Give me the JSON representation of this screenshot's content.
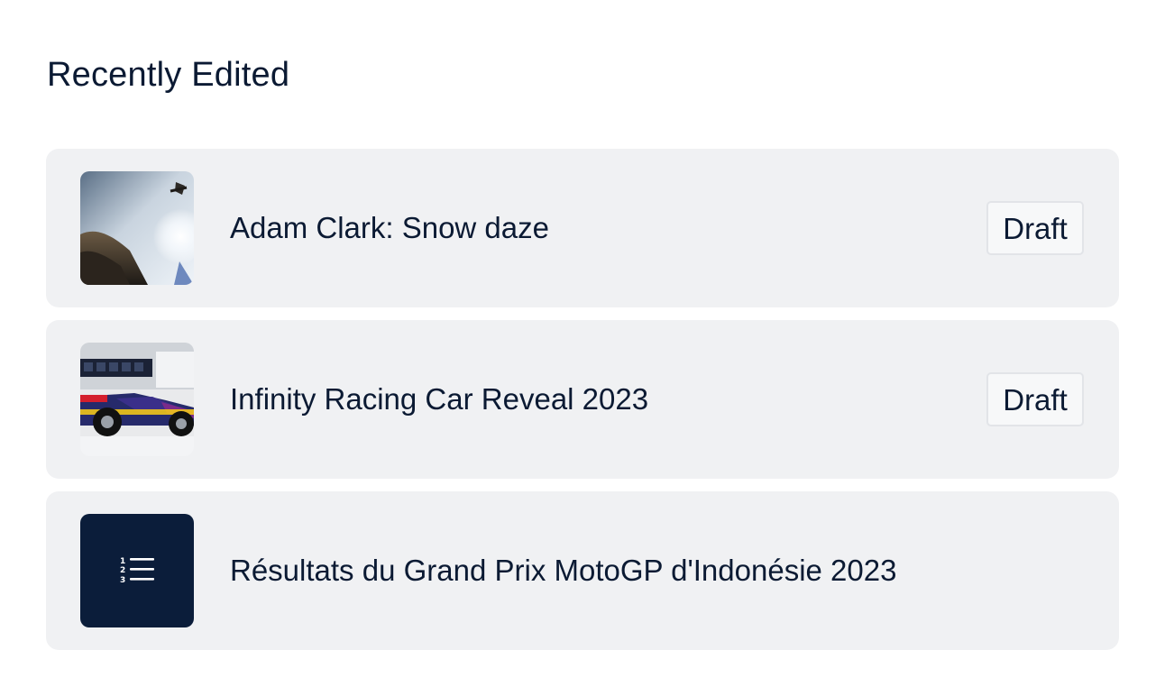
{
  "section": {
    "title": "Recently Edited"
  },
  "items": [
    {
      "title": "Adam Clark: Snow daze",
      "status": "Draft",
      "thumbnail": "snowboarder-photo"
    },
    {
      "title": "Infinity Racing Car Reveal 2023",
      "status": "Draft",
      "thumbnail": "f1-car-photo"
    },
    {
      "title": "Résultats du Grand Prix MotoGP d'Indonésie 2023",
      "status": "",
      "thumbnail": "numbered-list-icon"
    }
  ],
  "colors": {
    "text": "#0b1a33",
    "row_background": "#f0f1f3",
    "icon_tile": "#0b1d3a"
  }
}
